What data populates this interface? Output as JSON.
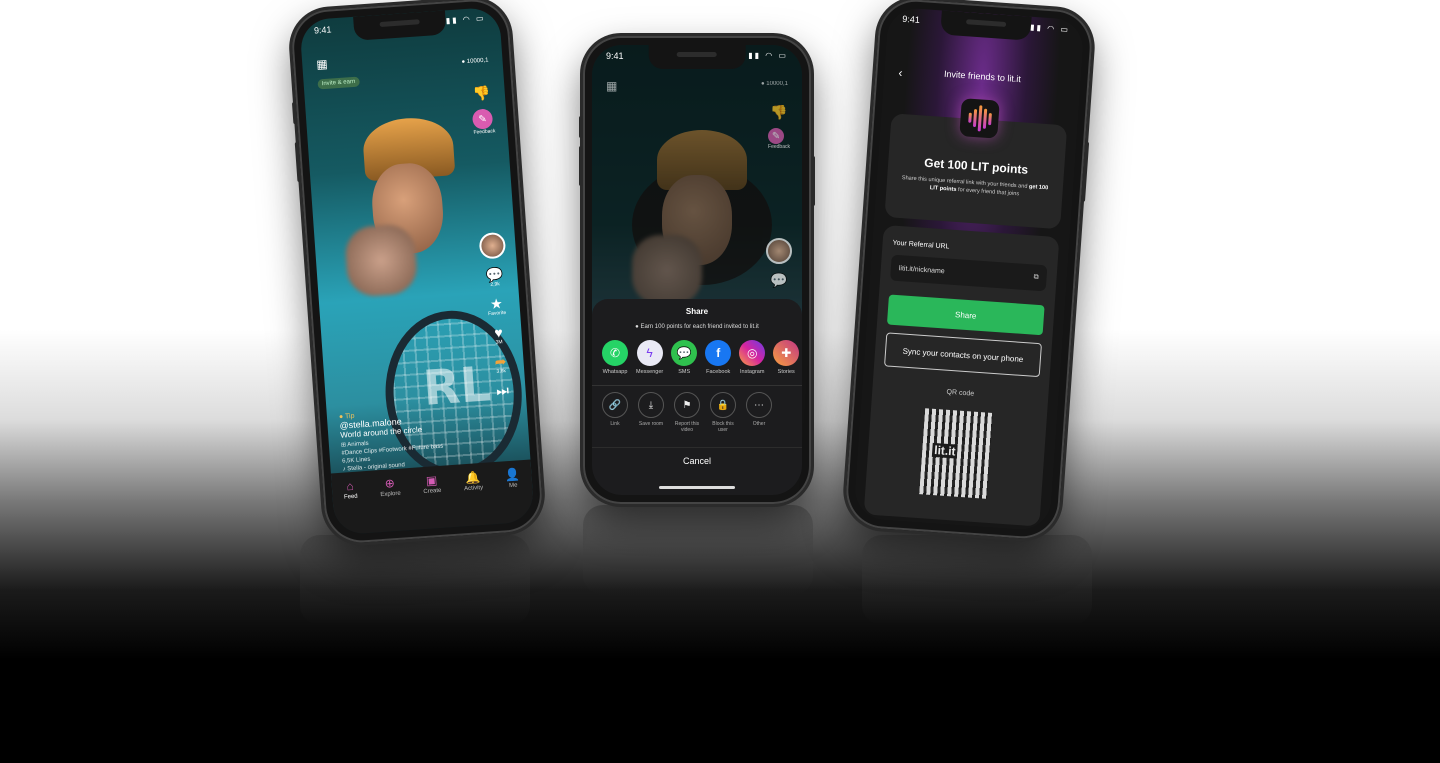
{
  "status_time": "9:41",
  "feed": {
    "earn_tag": "Invite & earn",
    "coins": "10000,1",
    "feedback_label": "Feedback",
    "side_counts": [
      "2,9k",
      "Favorite",
      "3M",
      "3,8k"
    ],
    "tip_label": "Tip",
    "username": "@stella.malone",
    "description": "World around the circle",
    "category": "Animals",
    "tags": "#Dance Clips  #Footwork  #Future bass",
    "views": "6,5K Lines",
    "sound": "Stella - original sound",
    "tabs": [
      "Feed",
      "Explore",
      "Create",
      "Activity",
      "Me"
    ],
    "racket_text": "RL"
  },
  "share_sheet": {
    "title": "Share",
    "earn_text": "Earn 100 points for each friend invited to lit.it",
    "apps": [
      {
        "label": "Whatsapp",
        "color": "#25D366",
        "icon": "whatsapp-icon"
      },
      {
        "label": "Messenger",
        "color": "#e9e9f5",
        "icon": "messenger-icon"
      },
      {
        "label": "SMS",
        "color": "#2fc14e",
        "icon": "sms-icon"
      },
      {
        "label": "Facebook",
        "color": "#1877F2",
        "icon": "facebook-icon"
      },
      {
        "label": "Instagram",
        "color": "#d6249f",
        "icon": "instagram-icon"
      },
      {
        "label": "Stories",
        "color": "#c13584",
        "icon": "stories-icon"
      }
    ],
    "actions": [
      "Link",
      "Save room",
      "Report this video",
      "Block this user",
      "Other"
    ],
    "cancel": "Cancel",
    "coins": "10000,1",
    "feedback_label": "Feedback"
  },
  "invite": {
    "title": "Invite friends to lit.it",
    "headline": "Get 100 LIT points",
    "body_start": "Share this unique referral link with your friends and ",
    "body_bold": "get 100 LIT points",
    "body_end": " for every friend that joins",
    "referral_label": "Your Referral URL",
    "referral_url": "litit.it/nickname",
    "share_button": "Share",
    "sync_button": "Sync your contacts on your phone",
    "qr_label": "QR code",
    "qr_text": "lit.it"
  }
}
